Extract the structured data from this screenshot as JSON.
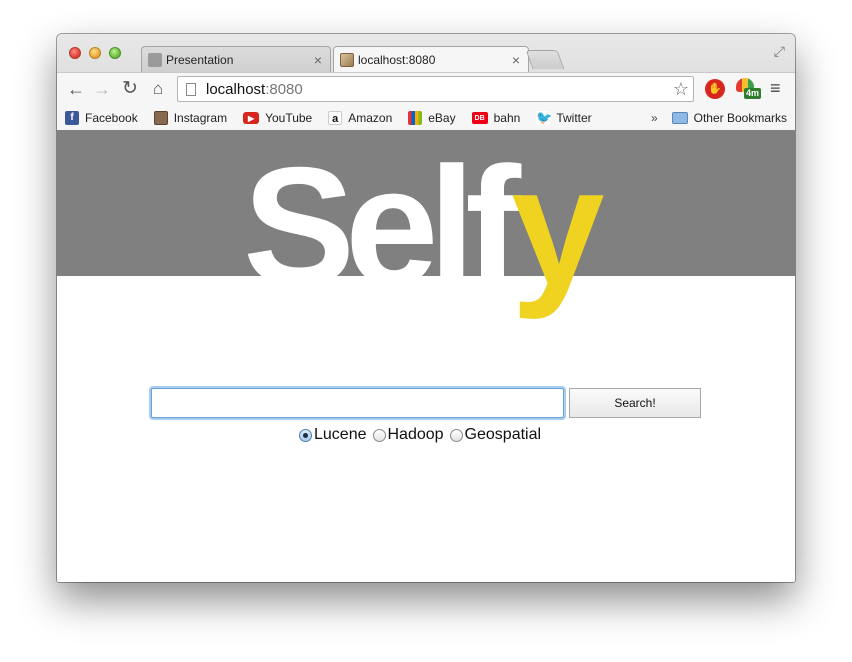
{
  "tabs": [
    {
      "title": "Presentation",
      "active": false,
      "close": "×",
      "favicon": "apple-favicon-icon"
    },
    {
      "title": "localhost:8080",
      "active": true,
      "close": "×",
      "favicon": "broken-image-favicon-icon"
    }
  ],
  "toolbar": {
    "back": "←",
    "forward": "→",
    "reload": "↻",
    "home": "⌂",
    "url_host": "localhost",
    "url_port": ":8080",
    "star": "☆",
    "menu": "≡",
    "ext_stop_label": "✋",
    "ext_badge": "4m"
  },
  "bookmarks": {
    "items": [
      {
        "label": "Facebook",
        "icon": "f"
      },
      {
        "label": "Instagram",
        "icon": ""
      },
      {
        "label": "YouTube",
        "icon": "▶"
      },
      {
        "label": "Amazon",
        "icon": "a"
      },
      {
        "label": "eBay",
        "icon": ""
      },
      {
        "label": "bahn",
        "icon": "DB"
      },
      {
        "label": "Twitter",
        "icon": "🐦"
      }
    ],
    "more": "»",
    "other": "Other Bookmarks"
  },
  "colors": {
    "banner": "#808080",
    "logo_main": "#ffffff",
    "logo_accent": "#f0d321"
  },
  "page": {
    "logo_main": "Self",
    "logo_accent": "y",
    "search_value": "",
    "search_button": "Search!",
    "radios": [
      {
        "label": "Lucene",
        "checked": true
      },
      {
        "label": "Hadoop",
        "checked": false
      },
      {
        "label": "Geospatial",
        "checked": false
      }
    ]
  }
}
